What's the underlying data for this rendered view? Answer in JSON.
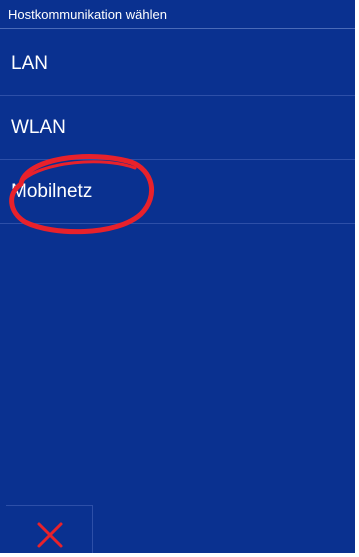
{
  "dialog": {
    "title": "Hostkommunikation wählen"
  },
  "options": [
    {
      "label": "LAN"
    },
    {
      "label": "WLAN"
    },
    {
      "label": "Mobilnetz",
      "highlighted": true
    }
  ],
  "colors": {
    "background": "#0a3190",
    "text": "#ffffff",
    "highlight": "#e8212b",
    "cancel": "#e8212b"
  },
  "cancel_button": {
    "icon": "close-icon"
  }
}
